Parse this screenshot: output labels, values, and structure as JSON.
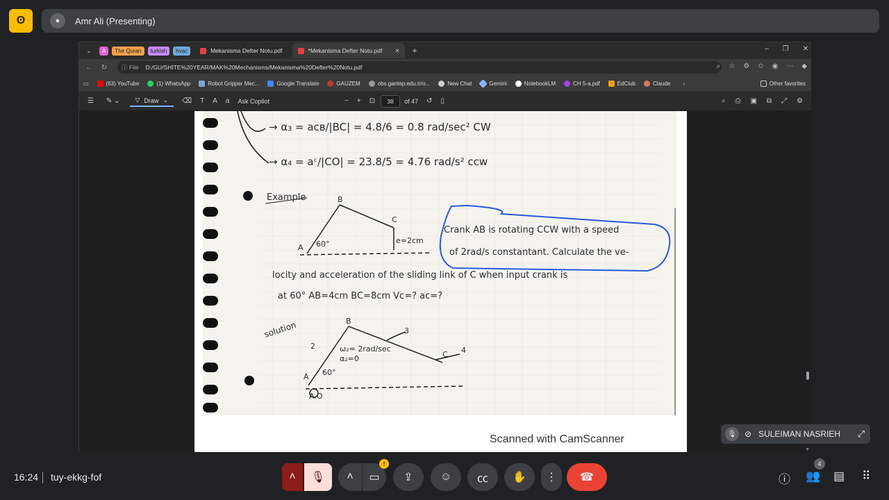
{
  "meet": {
    "presenting": "Amr Ali (Presenting)",
    "time": "16:24",
    "meeting_code": "tuy-ekkg-fof",
    "participant_tile_name": "SULEIMAN NASRIEH",
    "participant_count": "4"
  },
  "browser": {
    "tag1": "A",
    "tag2": "The Quran",
    "tag3": "turkish",
    "tag4": "hvac",
    "tab1_label": "Mekanisma Defter Notu.pdf",
    "tab2_label": "*Mekanisma Defter Notu.pdf",
    "file_chip": "File",
    "url": "D:/GU/SHITE%20YEAR/MAK%20Mechanisms/Mekanisma%20Defter%20Notu.pdf",
    "bookmarks": [
      "(63) YouTube",
      "(1) WhatsApp",
      "Robot Gripper Mec...",
      "Google Translate",
      "GAUZEM",
      "obs.gantep.edu.tr/o...",
      "New Chat",
      "Gemini",
      "NotebookLM",
      "CH 5-a.pdf",
      "EdClub",
      "Claude"
    ],
    "other_favorites": "Other favorites"
  },
  "pdf": {
    "draw_label": "Draw",
    "ask_copilot": "Ask Copilot",
    "page_number": "38",
    "page_total": "of 47",
    "scanner_watermark": "Scanned with CamScanner"
  },
  "colors": {
    "meet_bg": "#202124",
    "accent_red": "#ea4335",
    "accent_yellow": "#fbbc04",
    "ink_blue": "#2a5bd7"
  }
}
